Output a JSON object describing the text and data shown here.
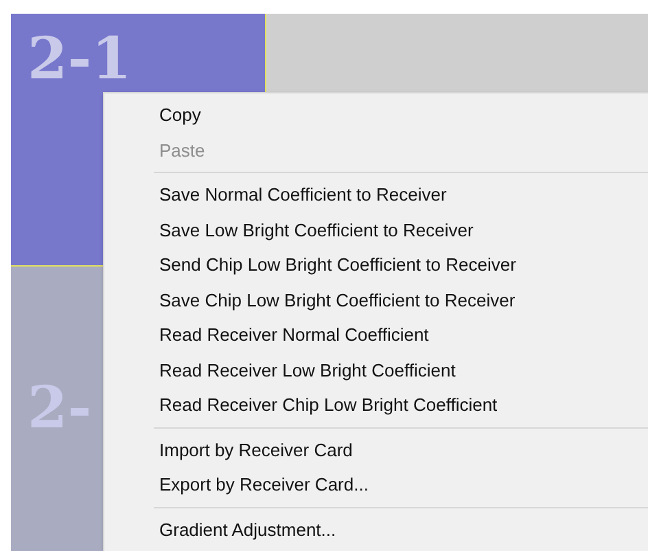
{
  "tiles": [
    {
      "label": "2-1",
      "color": "#7777cc"
    },
    {
      "color": "#cfcfcf"
    },
    {
      "label": "2-",
      "color": "#a9acc0"
    }
  ],
  "context_menu": {
    "items": [
      {
        "kind": "item",
        "label": "Copy",
        "disabled": false
      },
      {
        "kind": "item",
        "label": "Paste",
        "disabled": true
      },
      {
        "kind": "separator"
      },
      {
        "kind": "item",
        "label": "Save Normal Coefficient to Receiver",
        "disabled": false
      },
      {
        "kind": "item",
        "label": "Save Low Bright Coefficient to Receiver",
        "disabled": false
      },
      {
        "kind": "item",
        "label": "Send Chip Low Bright Coefficient to Receiver",
        "disabled": false
      },
      {
        "kind": "item",
        "label": "Save Chip Low Bright Coefficient to Receiver",
        "disabled": false
      },
      {
        "kind": "item",
        "label": "Read Receiver Normal Coefficient",
        "disabled": false
      },
      {
        "kind": "item",
        "label": "Read Receiver Low Bright Coefficient",
        "disabled": false
      },
      {
        "kind": "item",
        "label": "Read Receiver Chip Low Bright Coefficient",
        "disabled": false
      },
      {
        "kind": "separator"
      },
      {
        "kind": "item",
        "label": "Import by Receiver Card",
        "disabled": false
      },
      {
        "kind": "item",
        "label": "Export by Receiver Card...",
        "disabled": false
      },
      {
        "kind": "separator"
      },
      {
        "kind": "item",
        "label": "Gradient Adjustment...",
        "disabled": false
      }
    ]
  }
}
